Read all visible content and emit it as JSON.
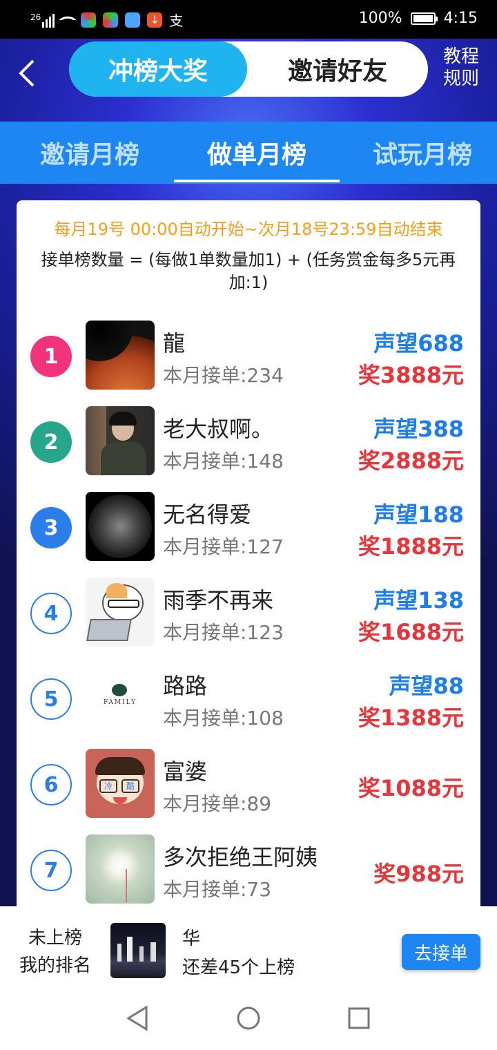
{
  "status": {
    "battery": "100%",
    "time": "4:15",
    "signal": "26"
  },
  "header": {
    "tab_active": "冲榜大奖",
    "tab_inactive": "邀请好友",
    "rules_line1": "教程",
    "rules_line2": "规则"
  },
  "tabs": [
    "邀请月榜",
    "做单月榜",
    "试玩月榜"
  ],
  "notice": "每月19号 00:00自动开始~次月18号23:59自动结束",
  "formula": "接单榜数量 = (每做1单数量加1) + (任务赏金每多5元再加:1)",
  "ranks": [
    {
      "no": "1",
      "name": "龍",
      "count": "本月接单:234",
      "prestige": "声望688",
      "prize": "奖3888元"
    },
    {
      "no": "2",
      "name": "老大叔啊。",
      "count": "本月接单:148",
      "prestige": "声望388",
      "prize": "奖2888元"
    },
    {
      "no": "3",
      "name": "无名得爱",
      "count": "本月接单:127",
      "prestige": "声望188",
      "prize": "奖1888元"
    },
    {
      "no": "4",
      "name": "雨季不再来",
      "count": "本月接单:123",
      "prestige": "声望138",
      "prize": "奖1688元"
    },
    {
      "no": "5",
      "name": "路路",
      "count": "本月接单:108",
      "prestige": "声望88",
      "prize": "奖1388元"
    },
    {
      "no": "6",
      "name": "富婆",
      "count": "本月接单:89",
      "prestige": "",
      "prize": "奖1088元"
    },
    {
      "no": "7",
      "name": "多次拒绝王阿姨",
      "count": "本月接单:73",
      "prestige": "",
      "prize": "奖988元"
    }
  ],
  "avatar_labels": {
    "family": "FAMILY",
    "cool_left": "冷",
    "cool_right": "酷"
  },
  "me": {
    "status": "未上榜",
    "label": "我的排名",
    "name": "华",
    "gap": "还差45个上榜",
    "button": "去接单"
  },
  "colors": {
    "rank1": "#f0337a",
    "rank2": "#26a68a",
    "rank3": "#2b7de9",
    "prestige": "#1e7de6",
    "prize": "#e3373c",
    "accent": "#1d86f2"
  }
}
